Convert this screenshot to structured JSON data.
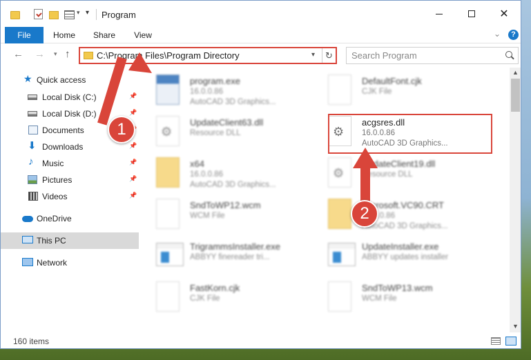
{
  "window": {
    "title": "Program",
    "close_glyph": "✕",
    "refresh_glyph": "↻",
    "back_glyph": "←",
    "forward_glyph": "→",
    "up_glyph": "↑",
    "dropdown_glyph": "▾",
    "chevron_glyph": "⌄",
    "help_glyph": "?"
  },
  "ribbon": {
    "tabs": [
      {
        "label": "File"
      },
      {
        "label": "Home"
      },
      {
        "label": "Share"
      },
      {
        "label": "View"
      }
    ]
  },
  "address_bar": {
    "path": "C:\\Program Files\\Program Directory"
  },
  "search": {
    "placeholder": "Search Program"
  },
  "sidebar": {
    "items": [
      {
        "label": "Quick access",
        "icon": "star-icon"
      },
      {
        "label": "Local Disk (C:)",
        "icon": "drive-icon"
      },
      {
        "label": "Local Disk (D:)",
        "icon": "drive-icon"
      },
      {
        "label": "Documents",
        "icon": "documents-icon"
      },
      {
        "label": "Downloads",
        "icon": "download-icon"
      },
      {
        "label": "Music",
        "icon": "music-icon"
      },
      {
        "label": "Pictures",
        "icon": "pictures-icon"
      },
      {
        "label": "Videos",
        "icon": "videos-icon"
      },
      {
        "label": "OneDrive",
        "icon": "cloud-icon"
      },
      {
        "label": "This PC",
        "icon": "computer-icon"
      },
      {
        "label": "Network",
        "icon": "network-icon"
      }
    ],
    "pin_glyph": "📌"
  },
  "files": [
    {
      "name": "program.exe",
      "line2": "16.0.0.86",
      "line3": "AutoCAD 3D Graphics...",
      "kind": "exe"
    },
    {
      "name": "DefaultFont.cjk",
      "line2": "CJK File",
      "line3": "",
      "kind": "doc"
    },
    {
      "name": "UpdateClient63.dll",
      "line2": "Resource DLL",
      "line3": "",
      "kind": "dll"
    },
    {
      "name": "acgsres.dll",
      "line2": "16.0.0.86",
      "line3": "AutoCAD 3D Graphics...",
      "kind": "dll"
    },
    {
      "name": "x64",
      "line2": "16.0.0.86",
      "line3": "AutoCAD 3D Graphics...",
      "kind": "folder"
    },
    {
      "name": "UpdateClient19.dll",
      "line2": "Resource DLL",
      "line3": "",
      "kind": "dll"
    },
    {
      "name": "SndToWP12.wcm",
      "line2": "WCM File",
      "line3": "",
      "kind": "doc"
    },
    {
      "name": "Microsoft.VC90.CRT",
      "line2": "16.0.0.86",
      "line3": "AutoCAD 3D Graphics...",
      "kind": "folder"
    },
    {
      "name": "TrigrammsInstaller.exe",
      "line2": "ABBYY finereader tri...",
      "line3": "",
      "kind": "app"
    },
    {
      "name": "UpdateInstaller.exe",
      "line2": "ABBYY updates installer",
      "line3": "",
      "kind": "app"
    },
    {
      "name": "FastKorn.cjk",
      "line2": "CJK File",
      "line3": "",
      "kind": "doc"
    },
    {
      "name": "SndToWP13.wcm",
      "line2": "WCM File",
      "line3": "",
      "kind": "doc"
    }
  ],
  "status": {
    "item_count": "160 items"
  },
  "callouts": {
    "step1": "1",
    "step2": "2"
  },
  "colors": {
    "accent": "#1979ca",
    "highlight": "#d9453a"
  }
}
